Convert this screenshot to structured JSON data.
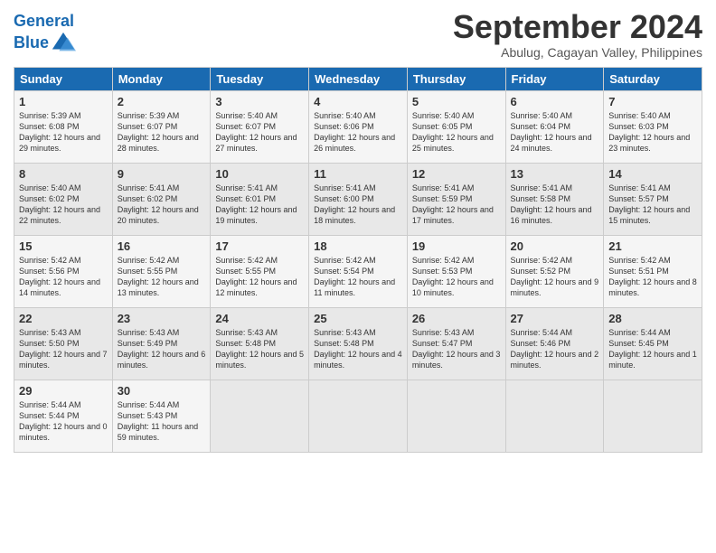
{
  "header": {
    "logo_line1": "General",
    "logo_line2": "Blue",
    "month_title": "September 2024",
    "location": "Abulug, Cagayan Valley, Philippines"
  },
  "days_of_week": [
    "Sunday",
    "Monday",
    "Tuesday",
    "Wednesday",
    "Thursday",
    "Friday",
    "Saturday"
  ],
  "weeks": [
    [
      {
        "day": "1",
        "content": "Sunrise: 5:39 AM\nSunset: 6:08 PM\nDaylight: 12 hours and 29 minutes."
      },
      {
        "day": "2",
        "content": "Sunrise: 5:39 AM\nSunset: 6:07 PM\nDaylight: 12 hours and 28 minutes."
      },
      {
        "day": "3",
        "content": "Sunrise: 5:40 AM\nSunset: 6:07 PM\nDaylight: 12 hours and 27 minutes."
      },
      {
        "day": "4",
        "content": "Sunrise: 5:40 AM\nSunset: 6:06 PM\nDaylight: 12 hours and 26 minutes."
      },
      {
        "day": "5",
        "content": "Sunrise: 5:40 AM\nSunset: 6:05 PM\nDaylight: 12 hours and 25 minutes."
      },
      {
        "day": "6",
        "content": "Sunrise: 5:40 AM\nSunset: 6:04 PM\nDaylight: 12 hours and 24 minutes."
      },
      {
        "day": "7",
        "content": "Sunrise: 5:40 AM\nSunset: 6:03 PM\nDaylight: 12 hours and 23 minutes."
      }
    ],
    [
      {
        "day": "8",
        "content": "Sunrise: 5:40 AM\nSunset: 6:02 PM\nDaylight: 12 hours and 22 minutes."
      },
      {
        "day": "9",
        "content": "Sunrise: 5:41 AM\nSunset: 6:02 PM\nDaylight: 12 hours and 20 minutes."
      },
      {
        "day": "10",
        "content": "Sunrise: 5:41 AM\nSunset: 6:01 PM\nDaylight: 12 hours and 19 minutes."
      },
      {
        "day": "11",
        "content": "Sunrise: 5:41 AM\nSunset: 6:00 PM\nDaylight: 12 hours and 18 minutes."
      },
      {
        "day": "12",
        "content": "Sunrise: 5:41 AM\nSunset: 5:59 PM\nDaylight: 12 hours and 17 minutes."
      },
      {
        "day": "13",
        "content": "Sunrise: 5:41 AM\nSunset: 5:58 PM\nDaylight: 12 hours and 16 minutes."
      },
      {
        "day": "14",
        "content": "Sunrise: 5:41 AM\nSunset: 5:57 PM\nDaylight: 12 hours and 15 minutes."
      }
    ],
    [
      {
        "day": "15",
        "content": "Sunrise: 5:42 AM\nSunset: 5:56 PM\nDaylight: 12 hours and 14 minutes."
      },
      {
        "day": "16",
        "content": "Sunrise: 5:42 AM\nSunset: 5:55 PM\nDaylight: 12 hours and 13 minutes."
      },
      {
        "day": "17",
        "content": "Sunrise: 5:42 AM\nSunset: 5:55 PM\nDaylight: 12 hours and 12 minutes."
      },
      {
        "day": "18",
        "content": "Sunrise: 5:42 AM\nSunset: 5:54 PM\nDaylight: 12 hours and 11 minutes."
      },
      {
        "day": "19",
        "content": "Sunrise: 5:42 AM\nSunset: 5:53 PM\nDaylight: 12 hours and 10 minutes."
      },
      {
        "day": "20",
        "content": "Sunrise: 5:42 AM\nSunset: 5:52 PM\nDaylight: 12 hours and 9 minutes."
      },
      {
        "day": "21",
        "content": "Sunrise: 5:42 AM\nSunset: 5:51 PM\nDaylight: 12 hours and 8 minutes."
      }
    ],
    [
      {
        "day": "22",
        "content": "Sunrise: 5:43 AM\nSunset: 5:50 PM\nDaylight: 12 hours and 7 minutes."
      },
      {
        "day": "23",
        "content": "Sunrise: 5:43 AM\nSunset: 5:49 PM\nDaylight: 12 hours and 6 minutes."
      },
      {
        "day": "24",
        "content": "Sunrise: 5:43 AM\nSunset: 5:48 PM\nDaylight: 12 hours and 5 minutes."
      },
      {
        "day": "25",
        "content": "Sunrise: 5:43 AM\nSunset: 5:48 PM\nDaylight: 12 hours and 4 minutes."
      },
      {
        "day": "26",
        "content": "Sunrise: 5:43 AM\nSunset: 5:47 PM\nDaylight: 12 hours and 3 minutes."
      },
      {
        "day": "27",
        "content": "Sunrise: 5:44 AM\nSunset: 5:46 PM\nDaylight: 12 hours and 2 minutes."
      },
      {
        "day": "28",
        "content": "Sunrise: 5:44 AM\nSunset: 5:45 PM\nDaylight: 12 hours and 1 minute."
      }
    ],
    [
      {
        "day": "29",
        "content": "Sunrise: 5:44 AM\nSunset: 5:44 PM\nDaylight: 12 hours and 0 minutes."
      },
      {
        "day": "30",
        "content": "Sunrise: 5:44 AM\nSunset: 5:43 PM\nDaylight: 11 hours and 59 minutes."
      },
      {
        "day": "",
        "content": ""
      },
      {
        "day": "",
        "content": ""
      },
      {
        "day": "",
        "content": ""
      },
      {
        "day": "",
        "content": ""
      },
      {
        "day": "",
        "content": ""
      }
    ]
  ]
}
